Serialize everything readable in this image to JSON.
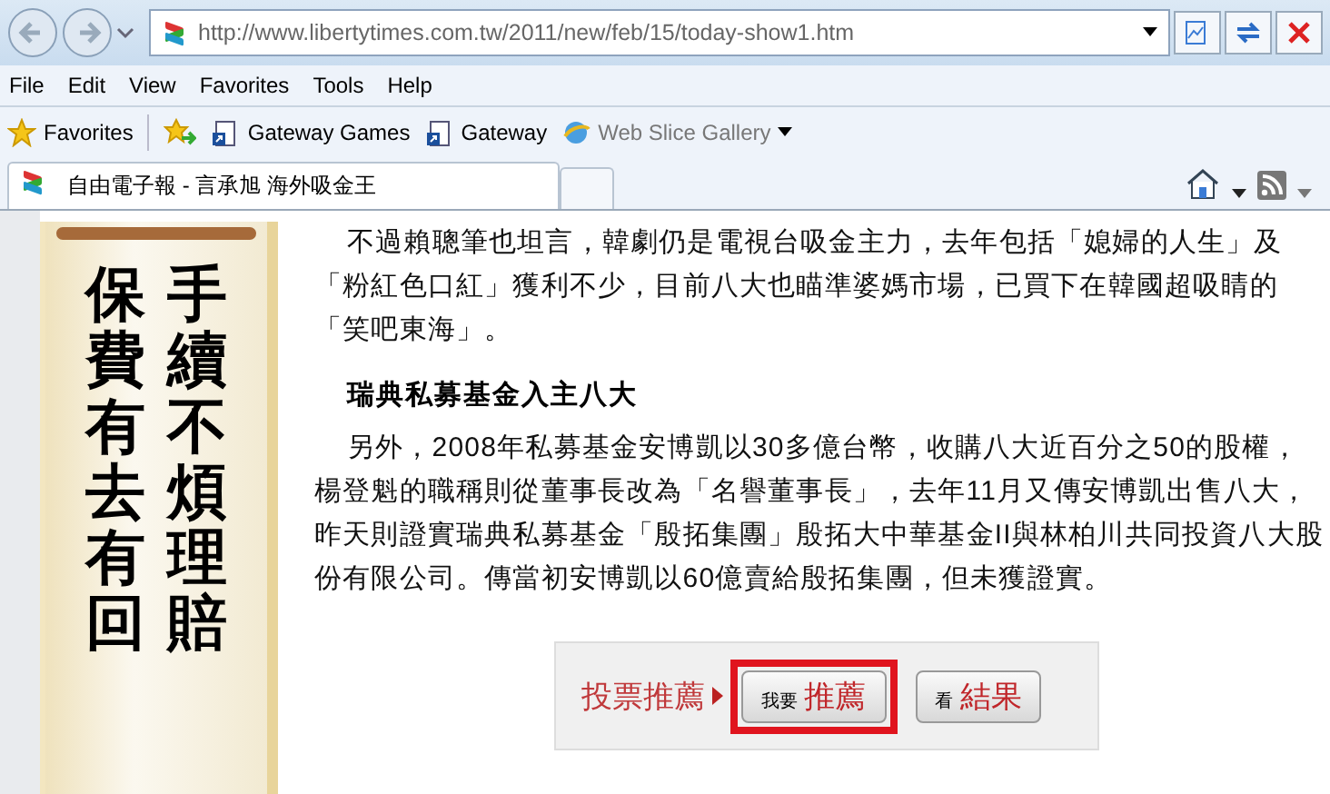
{
  "address_bar": {
    "url": "http://www.libertytimes.com.tw/2011/new/feb/15/today-show1.htm"
  },
  "menu": [
    "File",
    "Edit",
    "View",
    "Favorites",
    "Tools",
    "Help"
  ],
  "favorites_bar": {
    "label": "Favorites",
    "links": [
      {
        "label": "Gateway Games",
        "kind": "shortcut"
      },
      {
        "label": "Gateway",
        "kind": "shortcut"
      },
      {
        "label": "Web Slice Gallery",
        "kind": "gallery"
      }
    ]
  },
  "tabs": [
    {
      "label": "自由電子報 - 言承旭 海外吸金王",
      "selected": true
    }
  ],
  "banner": {
    "columns": [
      "保費有去有回",
      "手續不煩理賠"
    ]
  },
  "article": [
    {
      "kind": "paragraph",
      "text": "不過賴聰筆也坦言，韓劇仍是電視台吸金主力，去年包括「媳婦的人生」及「粉紅色口紅」獲利不少，目前八大也瞄準婆媽市場，已買下在韓國超吸睛的「笑吧東海」。"
    },
    {
      "kind": "heading",
      "text": "瑞典私募基金入主八大"
    },
    {
      "kind": "paragraph",
      "text": "另外，2008年私募基金安博凱以30多億台幣，收購八大近百分之50的股權，楊登魁的職稱則從董事長改為「名譽董事長」，去年11月又傳安博凱出售八大，昨天則證實瑞典私募基金「殷拓集團」殷拓大中華基金II與林柏川共同投資八大股份有限公司。傳當初安博凱以60億賣給殷拓集團，但未獲證實。"
    }
  ],
  "vote": {
    "label": "投票推薦",
    "buttons": [
      {
        "prefix": "我要",
        "label": "推薦",
        "selected": true
      },
      {
        "prefix": "看",
        "label": "結果",
        "selected": false
      }
    ]
  }
}
